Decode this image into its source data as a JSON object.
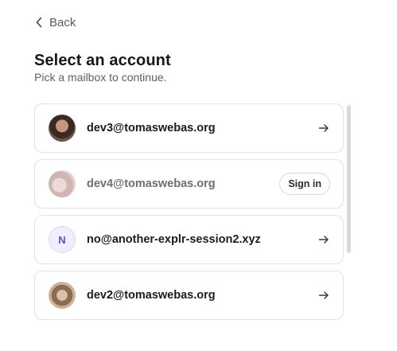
{
  "nav": {
    "back_label": "Back"
  },
  "header": {
    "title": "Select an account",
    "subtitle": "Pick a mailbox to continue."
  },
  "accounts": [
    {
      "email": "dev3@tomaswebas.org",
      "avatar": "photo",
      "action": "arrow-right-icon"
    },
    {
      "email": "dev4@tomaswebas.org",
      "avatar": "photo",
      "action_label": "Sign in"
    },
    {
      "email": "no@another-explr-session2.xyz",
      "avatar_initial": "N",
      "action": "arrow-right-icon"
    },
    {
      "email": "dev2@tomaswebas.org",
      "avatar": "photo",
      "action": "arrow-right-icon"
    }
  ],
  "colors": {
    "accent": "#5a4fd6",
    "border": "#e3e3e3",
    "text": "#1c1c1c",
    "muted": "#5f5f5f"
  }
}
